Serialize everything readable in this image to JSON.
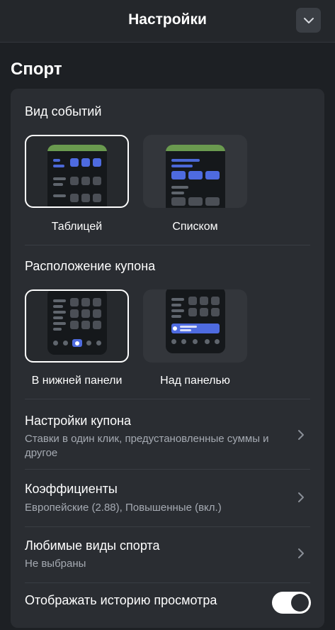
{
  "header": {
    "title": "Настройки",
    "collapse_icon": "chevron-down-icon"
  },
  "section": {
    "title": "Спорт"
  },
  "event_view": {
    "title": "Вид событий",
    "options": [
      {
        "label": "Таблицей",
        "selected": true
      },
      {
        "label": "Списком",
        "selected": false
      }
    ]
  },
  "coupon_position": {
    "title": "Расположение купона",
    "options": [
      {
        "label": "В нижней панели",
        "selected": true
      },
      {
        "label": "Над панелью",
        "selected": false
      }
    ]
  },
  "rows": [
    {
      "title": "Настройки купона",
      "subtitle": "Ставки в один клик, предустановленные суммы и другое",
      "icon": "chevron-right-icon"
    },
    {
      "title": "Коэффициенты",
      "subtitle": "Европейские (2.88), Повышенные (вкл.)",
      "icon": "chevron-right-icon"
    },
    {
      "title": "Любимые виды спорта",
      "subtitle": "Не выбраны",
      "icon": "chevron-right-icon"
    }
  ],
  "history_toggle": {
    "label": "Отображать историю просмотра",
    "on": true
  },
  "colors": {
    "accent": "#4e6be0",
    "background": "#1d2024",
    "card": "#2a2d32",
    "phone_header": "#6a9a4f"
  }
}
